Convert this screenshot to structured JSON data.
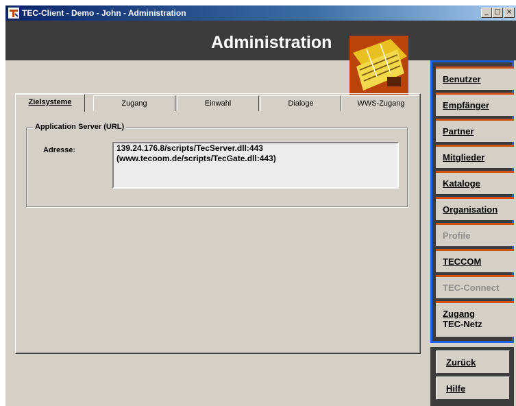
{
  "window": {
    "title": "TEC-Client - Demo - John - Administration",
    "controls": [
      "_",
      "□",
      "×"
    ]
  },
  "header": {
    "title": "Administration",
    "logo_icon": "tec-logo-icon"
  },
  "tabs": [
    {
      "label": "Zielsysteme",
      "active": true
    },
    {
      "label": "Zugang",
      "active": false
    },
    {
      "label": "Einwahl",
      "active": false
    },
    {
      "label": "Dialoge",
      "active": false
    },
    {
      "label": "WWS-Zugang",
      "active": false
    }
  ],
  "group": {
    "legend": "Application Server (URL)",
    "address_label": "Adresse:",
    "address_lines": [
      "139.24.176.8/scripts/TecServer.dll:443",
      "(www.tecoom.de/scripts/TecGate.dll:443)"
    ]
  },
  "sidebar": {
    "items": [
      {
        "label": "Benutzer",
        "enabled": true
      },
      {
        "label": "Empfänger",
        "enabled": true
      },
      {
        "label": "Partner",
        "enabled": true
      },
      {
        "label": "Mitglieder",
        "enabled": true
      },
      {
        "label": "Kataloge",
        "enabled": true
      },
      {
        "label": "Organisation",
        "enabled": true
      },
      {
        "label": "Profile",
        "enabled": false
      },
      {
        "label": "TECCOM",
        "enabled": true
      },
      {
        "label": "TEC-Connect",
        "enabled": false
      },
      {
        "label_line1": "Zugang",
        "label_line2": "TEC-Netz",
        "enabled": true
      }
    ]
  },
  "bottom_buttons": [
    {
      "label": "Zurück"
    },
    {
      "label": "Hilfe"
    }
  ],
  "colors": {
    "sidebar_border": "#1f5fe0",
    "button_accent": "#d2500a",
    "header_bg": "#3c3c3c",
    "window_bg": "#d4d0c8"
  }
}
